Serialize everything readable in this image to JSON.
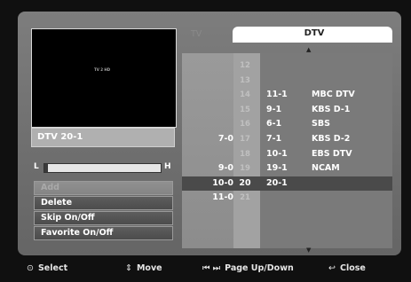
{
  "preview": {
    "caption": "TV 2 HD",
    "channel_label": "DTV 20-1"
  },
  "signal": {
    "low_label": "L",
    "high_label": "H",
    "level_percent": 3
  },
  "menu": {
    "add": "Add",
    "delete": "Delete",
    "skip": "Skip On/Off",
    "favorite": "Favorite On/Off"
  },
  "tabs": {
    "tv": "TV",
    "dtv": "DTV"
  },
  "channels": [
    {
      "major": "",
      "num": "12",
      "ch": "",
      "name": ""
    },
    {
      "major": "",
      "num": "13",
      "ch": "",
      "name": ""
    },
    {
      "major": "",
      "num": "14",
      "ch": "11-1",
      "name": "MBC DTV"
    },
    {
      "major": "",
      "num": "15",
      "ch": "9-1",
      "name": "KBS D-1"
    },
    {
      "major": "",
      "num": "16",
      "ch": "6-1",
      "name": "SBS"
    },
    {
      "major": "7-0",
      "num": "17",
      "ch": "7-1",
      "name": "KBS D-2"
    },
    {
      "major": "",
      "num": "18",
      "ch": "10-1",
      "name": "EBS DTV"
    },
    {
      "major": "9-0",
      "num": "19",
      "ch": "19-1",
      "name": "NCAM"
    },
    {
      "major": "10-0",
      "num": "20",
      "ch": "20-1",
      "name": "",
      "selected": true
    },
    {
      "major": "11-0",
      "num": "21",
      "ch": "",
      "name": ""
    }
  ],
  "footer": {
    "select": "Select",
    "move": "Move",
    "page": "Page Up/Down",
    "close": "Close"
  }
}
